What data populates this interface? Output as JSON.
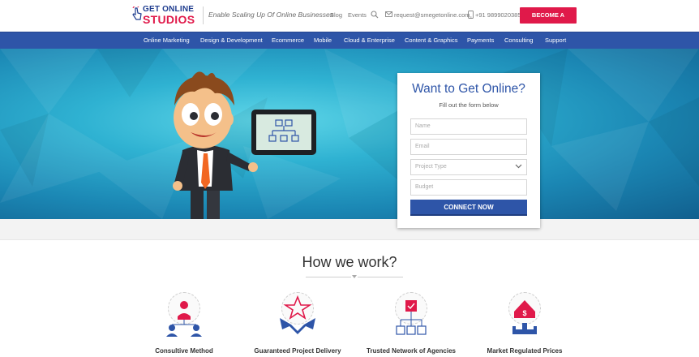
{
  "header": {
    "logo_line1": "GET ONLINE",
    "logo_line2": "STUDIOS",
    "tagline": "Enable Scaling Up Of Online Businesses",
    "links": [
      "Blog",
      "Events"
    ],
    "email": "request@smegetonline.com",
    "phone": "+91 9899020385",
    "cta": "BECOME A STUDIO",
    "icons": [
      "hand-pointer-icon",
      "search-icon",
      "mail-icon",
      "phone-icon"
    ]
  },
  "nav": {
    "items": [
      "Online Marketing",
      "Design & Development",
      "Ecommerce",
      "Mobile",
      "Cloud & Enterprise",
      "Content & Graphics",
      "Payments",
      "Consulting",
      "Support"
    ]
  },
  "form": {
    "title": "Want to Get Online?",
    "subtitle": "Fill out the form below",
    "name_placeholder": "Name",
    "email_placeholder": "Email",
    "project_type": "Project Type",
    "budget_placeholder": "Budget",
    "submit": "CONNECT NOW"
  },
  "how_we_work": {
    "title": "How we work?",
    "features": [
      {
        "label": "Consultive Method",
        "icon": "consultants-icon"
      },
      {
        "label": "Guaranteed Project Delivery",
        "icon": "star-ribbon-icon"
      },
      {
        "label": "Trusted Network of Agencies",
        "icon": "network-icon"
      },
      {
        "label": "Market Regulated Prices",
        "icon": "price-tag-icon"
      }
    ]
  },
  "colors": {
    "brand_blue": "#2e55a8",
    "brand_pink": "#e0194a",
    "hero_cyan": "#2fb2d2"
  }
}
